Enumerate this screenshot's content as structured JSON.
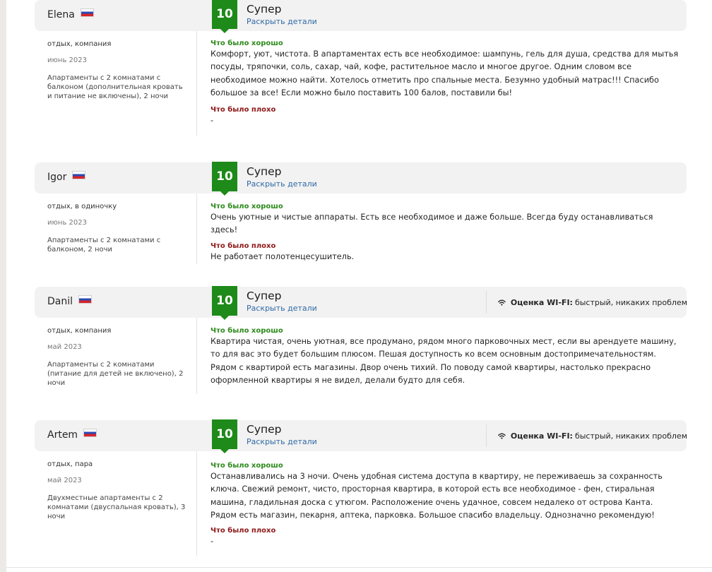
{
  "reviews": [
    {
      "name": "Elena",
      "flag_icon": "russia-flag",
      "score": "10",
      "score_title": "Супер",
      "details_link": "Раскрыть детали",
      "trip_type": "отдых, компания",
      "stay_date": "июнь 2023",
      "room_info": "Апартаменты с 2 комнатами с балконом (дополнительная кровать и питание не включены), 2 ночи",
      "good_label": "Что было хорошо",
      "good_text": "Комфорт, уют, чистота. В апартаментах есть все необходимое: шампунь, гель для душа, средства для мытья посуды, тряпочки, соль, сахар, чай, кофе, растительное масло и многое другое. Одним словом все необходимое можно найти. Хотелось отметить про спальные места. Безумно удобный матрас!!! Спасибо большое за все! Если можно было поставить 100 балов, поставили бы!",
      "bad_label": "Что было плохо",
      "bad_text": "-"
    },
    {
      "name": "Igor",
      "flag_icon": "russia-flag",
      "score": "10",
      "score_title": "Супер",
      "details_link": "Раскрыть детали",
      "trip_type": "отдых, в одиночку",
      "stay_date": "июнь 2023",
      "room_info": "Апартаменты с 2 комнатами с балконом, 2 ночи",
      "good_label": "Что было хорошо",
      "good_text": "Очень уютные и чистые аппараты. Есть все необходимое и даже больше. Всегда буду останавливаться здесь!",
      "bad_label": "Что было плохо",
      "bad_text": "Не работает полотенцесушитель."
    },
    {
      "name": "Danil",
      "flag_icon": "russia-flag",
      "score": "10",
      "score_title": "Супер",
      "details_link": "Раскрыть детали",
      "wifi_label": "Оценка WI-FI:",
      "wifi_value": "быстрый, никаких проблем",
      "trip_type": "отдых, компания",
      "stay_date": "май 2023",
      "room_info": "Апартаменты с 2 комнатами (питание для детей не включено), 2 ночи",
      "good_label": "Что было хорошо",
      "good_text": "Квартира чистая, очень уютная, все продумано, рядом много парковочных мест, если вы арендуете машину, то для вас это будет большим плюсом. Пешая доступность ко всем основным достопримечательностям. Рядом с квартирой есть магазины. Двор очень тихий. По поводу самой квартиры, настолько прекрасно оформленной квартиры я не видел, делали будто для себя."
    },
    {
      "name": "Artem",
      "flag_icon": "russia-flag",
      "score": "10",
      "score_title": "Супер",
      "details_link": "Раскрыть детали",
      "wifi_label": "Оценка WI-FI:",
      "wifi_value": "быстрый, никаких проблем",
      "trip_type": "отдых, пара",
      "stay_date": "май 2023",
      "room_info": "Двухместные апартаменты с 2 комнатами (двуспальная кровать), 3 ночи",
      "good_label": "Что было хорошо",
      "good_text": "Останавливались на 3 ночи. Очень удобная система доступа в квартиру, не переживаешь за сохранность ключа. Свежий ремонт, чисто, просторная квартира, в которой есть все необходимое - фен, стиральная машина, гладильная доска с утюгом. Расположение очень удачное, совсем недалеко от острова Канта. Рядом есть магазин, пекарня, аптека, парковка. Большое спасибо владельцу. Однозначно рекомендую!",
      "bad_label": "Что было плохо",
      "bad_text": "-"
    }
  ],
  "colors": {
    "score_badge": "#1e8a19",
    "good_label": "#2c8a1b",
    "bad_label": "#8e1717",
    "link": "#2f6aa6",
    "header_bg": "#f2f2f2"
  }
}
